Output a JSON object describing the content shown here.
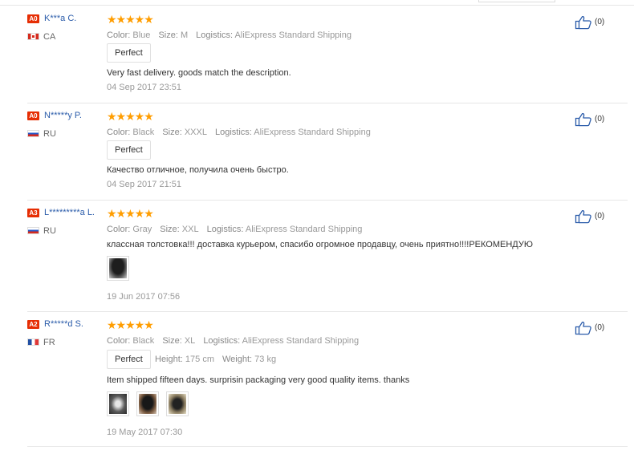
{
  "reviews": [
    {
      "level": "A0",
      "user": "K***a C.",
      "country": "CA",
      "stars": "★★★★★",
      "color_label": "Color:",
      "color": "Blue",
      "size_label": "Size:",
      "size": "M",
      "logistics_label": "Logistics:",
      "logistics": "AliExpress Standard Shipping",
      "tag": "Perfect",
      "text": "Very fast delivery. goods match the description.",
      "date": "04 Sep 2017 23:51",
      "likes": "(0)"
    },
    {
      "level": "A0",
      "user": "N*****y P.",
      "country": "RU",
      "stars": "★★★★★",
      "color_label": "Color:",
      "color": "Black",
      "size_label": "Size:",
      "size": "XXXL",
      "logistics_label": "Logistics:",
      "logistics": "AliExpress Standard Shipping",
      "tag": "Perfect",
      "text": "Качество отличное, получила очень быстро.",
      "date": "04 Sep 2017 21:51",
      "likes": "(0)"
    },
    {
      "level": "A3",
      "user": "L*********a L.",
      "country": "RU",
      "stars": "★★★★★",
      "color_label": "Color:",
      "color": "Gray",
      "size_label": "Size:",
      "size": "XXL",
      "logistics_label": "Logistics:",
      "logistics": "AliExpress Standard Shipping",
      "text": "классная толстовка!!! доставка курьером, спасибо огромное продавцу, очень приятно!!!!РЕКОМЕНДУЮ",
      "date": "19 Jun 2017 07:56",
      "likes": "(0)"
    },
    {
      "level": "A2",
      "user": "R*****d S.",
      "country": "FR",
      "stars": "★★★★★",
      "color_label": "Color:",
      "color": "Black",
      "size_label": "Size:",
      "size": "XL",
      "logistics_label": "Logistics:",
      "logistics": "AliExpress Standard Shipping",
      "tag": "Perfect",
      "height_label": "Height:",
      "height": "175 cm",
      "weight_label": "Weight:",
      "weight": "73 kg",
      "text": "Item shipped fifteen days. surprisin packaging very good quality items. thanks",
      "date": "19 May 2017 07:30",
      "likes": "(0)"
    }
  ],
  "colors": {
    "star": "#ff9d00",
    "username": "#2b5caa",
    "level_badge": "#e62e04"
  }
}
